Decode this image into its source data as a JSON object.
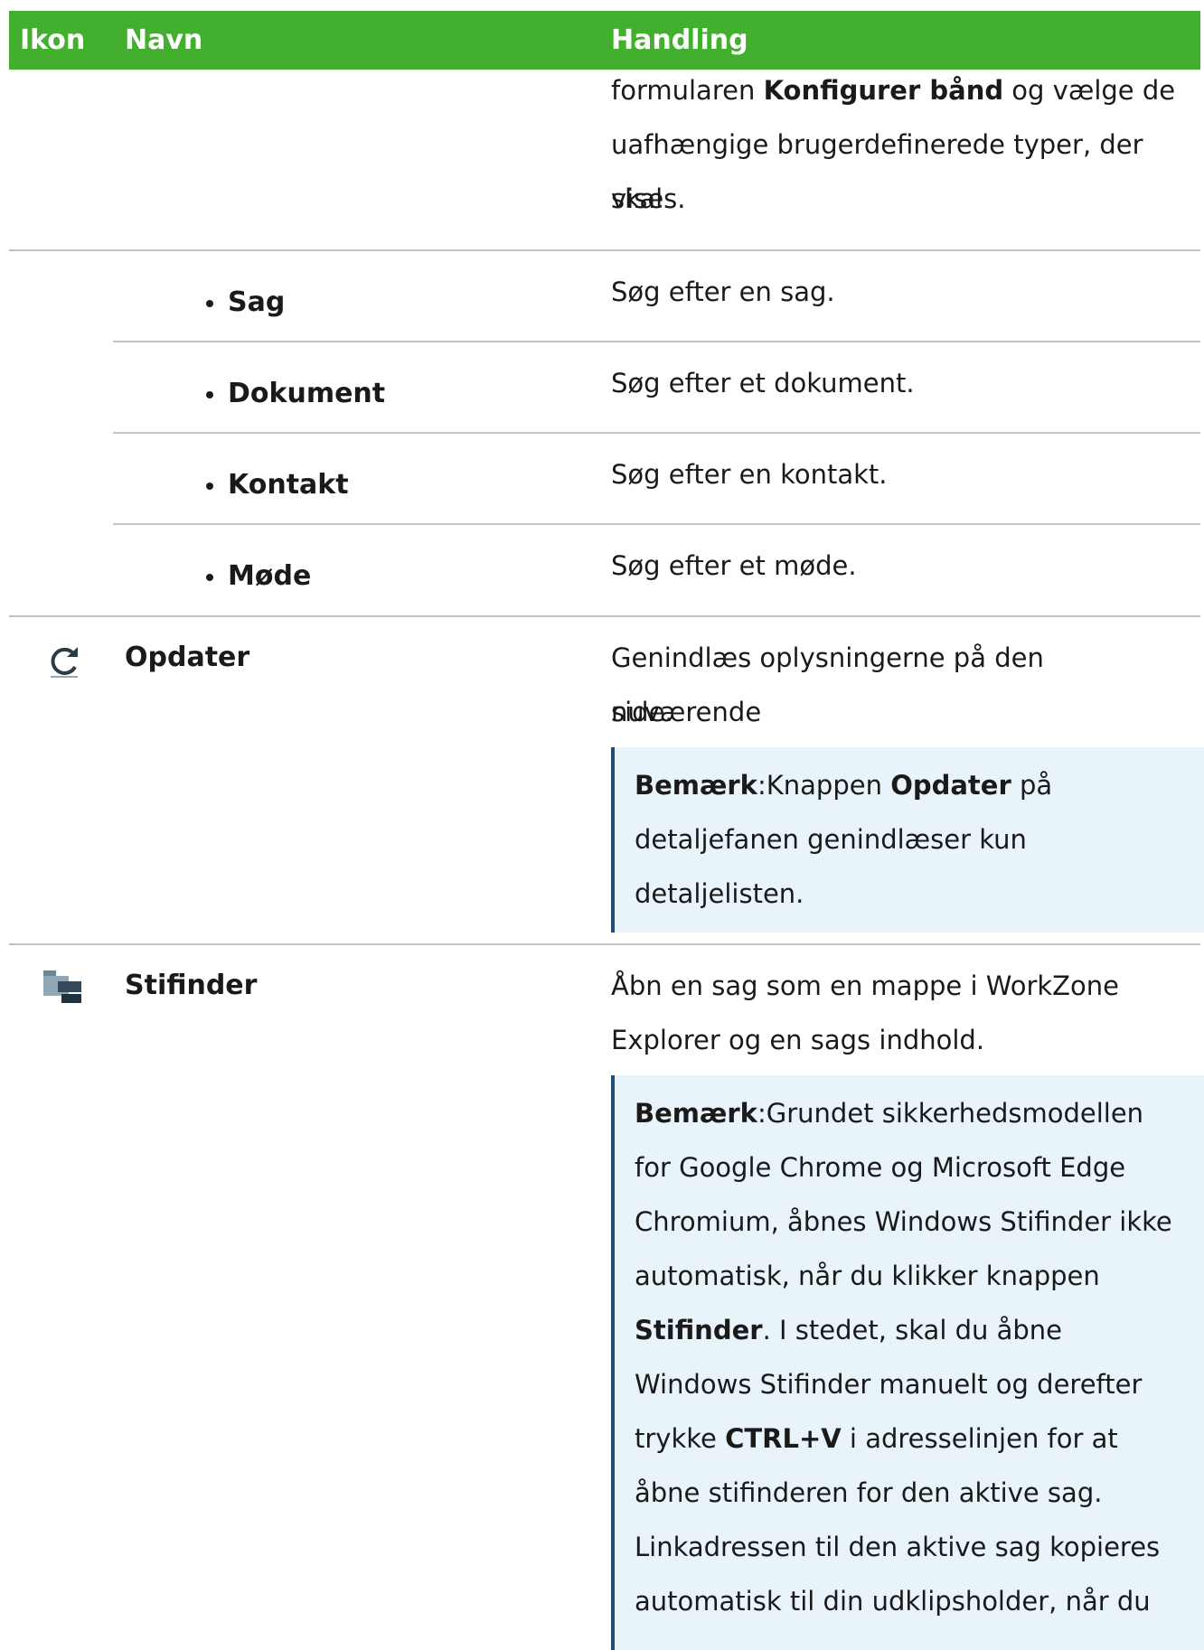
{
  "header": {
    "col_icon": "Ikon",
    "col_name": "Navn",
    "col_action": "Handling"
  },
  "row_top": {
    "line1_pre": "formularen ",
    "line1_bold": "Konfigurer bånd",
    "line1_post": " og vælge de",
    "line2": "uafhængige brugerdefinerede typer, der skal",
    "line3": "vises."
  },
  "sub_items": [
    {
      "name": "Sag",
      "action": "Søg efter en sag."
    },
    {
      "name": "Dokument",
      "action": "Søg efter et dokument."
    },
    {
      "name": "Kontakt",
      "action": "Søg efter en kontakt."
    },
    {
      "name": "Møde",
      "action": "Søg efter et møde."
    }
  ],
  "row_refresh": {
    "icon": "refresh-icon",
    "name": "Opdater",
    "action_line1": "Genindlæs oplysningerne på den nuværende",
    "action_line2": "side.",
    "note_label": "Bemærk",
    "note_colon": ":",
    "note_l1_pre": "Knappen ",
    "note_l1_bold": "Opdater",
    "note_l1_post": " på",
    "note_l2": "detaljefanen genindlæser kun",
    "note_l3": "detaljelisten."
  },
  "row_explorer": {
    "icon": "file-explorer-icon",
    "name": "Stifinder",
    "action_line1": "Åbn en sag som en mappe i WorkZone",
    "action_line2": "Explorer og en sags indhold.",
    "note_label": "Bemærk",
    "note_colon": ":",
    "note_l1": "Grundet sikkerhedsmodellen",
    "note_l2": "for Google Chrome og Microsoft Edge",
    "note_l3": "Chromium, åbnes Windows Stifinder ikke",
    "note_l4": "automatisk, når du klikker knappen",
    "note_l5_bold": "Stifinder",
    "note_l5_post": ". I stedet, skal du åbne",
    "note_l6": "Windows Stifinder manuelt og derefter",
    "note_l7_pre": "trykke ",
    "note_l7_bold": "CTRL+V",
    "note_l7_post": " i adresselinjen for at",
    "note_l8": "åbne stifinderen for den aktive sag.",
    "note_l9": "Linkadressen til den aktive sag kopieres",
    "note_l10": "automatisk til din udklipsholder, når du"
  },
  "colors": {
    "header_bg": "#42b02e",
    "note_bg": "#e9f3fa",
    "note_border": "#1f4e79",
    "rule": "#c3c3c3"
  }
}
